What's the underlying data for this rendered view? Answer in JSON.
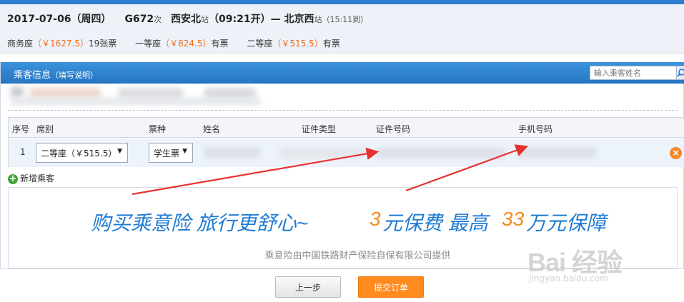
{
  "train": {
    "date": "2017-07-06（周四）",
    "train_no": "G672",
    "train_suffix": "次",
    "from_station": "西安北",
    "station_suffix": "站",
    "depart": "（09:21开）",
    "separator": "—",
    "to_station": "北京西",
    "arrive": "（15:11到）"
  },
  "seats": [
    {
      "name": "商务座",
      "price": "（￥1627.5）",
      "availability": "19张票"
    },
    {
      "name": "一等座",
      "price": "（￥824.5）",
      "availability": "有票"
    },
    {
      "name": "二等座",
      "price": "（￥515.5）",
      "availability": "有票"
    }
  ],
  "panel": {
    "title": "乘客信息",
    "subtitle": "（填写说明）",
    "search_placeholder": "输入乘客姓名"
  },
  "table": {
    "headers": [
      "序号",
      "席别",
      "票种",
      "姓名",
      "证件类型",
      "证件号码",
      "手机号码"
    ],
    "rows": [
      {
        "index": "1",
        "seat": "二等座（￥515.5）",
        "ticket_type": "学生票"
      }
    ]
  },
  "add_passenger_label": "新增乘客",
  "insurance": {
    "slogan_left": "购买乘意险  旅行更舒心~",
    "slogan_num1": "3",
    "slogan_mid": "元保费  最高",
    "slogan_num2": "33",
    "slogan_right": "万元保障",
    "caption": "乘意险由中国铁路财产保险自保有限公司提供"
  },
  "buttons": {
    "prev": "上一步",
    "submit": "提交订单"
  },
  "watermark": {
    "main": "Bai 经验",
    "sub": "jingyan.baidu.com"
  },
  "colors": {
    "accent_blue": "#2676c4",
    "price_orange": "#f26d1c",
    "submit_orange": "#ff8a1e",
    "arrow_red": "#e8322f"
  }
}
